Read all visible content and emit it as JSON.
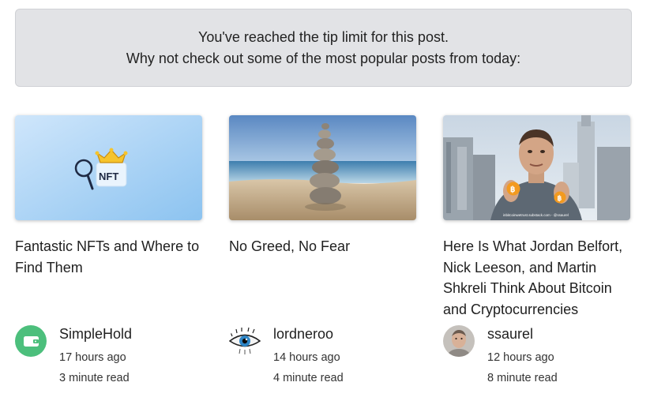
{
  "notice": {
    "line1": "You've reached the tip limit for this post.",
    "line2": "Why not check out some of the most popular posts from today:"
  },
  "posts": [
    {
      "title": "Fantastic NFTs and Where to Find Them",
      "author": "SimpleHold",
      "time": "17 hours ago",
      "read": "3 minute read",
      "thumb_text": "NFT",
      "thumb_icon": "nft-crown-magnifier-icon",
      "avatar_icon": "wallet-icon",
      "avatar_color": "#4cbf7c"
    },
    {
      "title": "No Greed, No Fear",
      "author": "lordneroo",
      "time": "14 hours ago",
      "read": "4 minute read",
      "thumb_icon": "stacked-stones-photo",
      "avatar_icon": "eye-icon"
    },
    {
      "title": "Here Is What Jordan Belfort, Nick Leeson, and Martin Shkreli Think About Bitcoin and Cryptocurrencies",
      "author": "ssaurel",
      "time": "12 hours ago",
      "read": "8 minute read",
      "thumb_caption": "inbitcoinwetrust.substack.com - @ssaurel",
      "thumb_icon": "man-with-bitcoin-photo",
      "avatar_icon": "user-photo-icon"
    }
  ]
}
